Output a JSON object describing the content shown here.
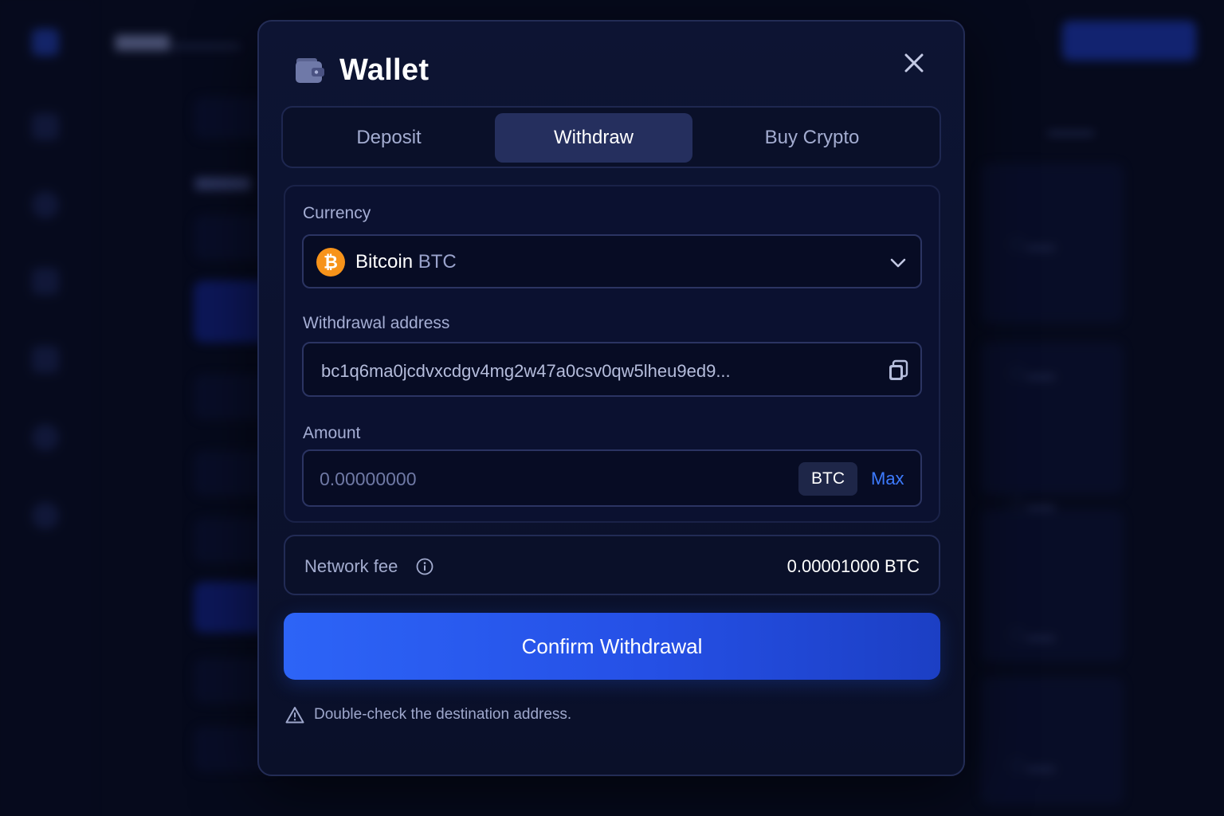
{
  "modal": {
    "title": "Wallet",
    "tabs": [
      {
        "label": "Deposit",
        "active": false
      },
      {
        "label": "Withdraw",
        "active": true
      },
      {
        "label": "Buy Crypto",
        "active": false
      }
    ]
  },
  "currency": {
    "label": "Currency",
    "name": "Bitcoin",
    "ticker": "BTC",
    "icon": "bitcoin-icon",
    "coin_color": "#f7931a"
  },
  "address": {
    "label": "Withdrawal address",
    "value": "bc1q6ma0jcdvxcdgv4mg2w47a0csv0qw5lheu9ed9..."
  },
  "amount": {
    "label": "Amount",
    "placeholder": "0.00000000",
    "unit": "BTC",
    "max_label": "Max"
  },
  "fee": {
    "label": "Network fee",
    "value": "0.00001000 BTC"
  },
  "confirm_label": "Confirm Withdrawal",
  "warning": "Double-check the destination address.",
  "colors": {
    "accent": "#2d64f7",
    "link": "#3d7bff",
    "bitcoin": "#f7931a",
    "background": "#060a1c"
  }
}
